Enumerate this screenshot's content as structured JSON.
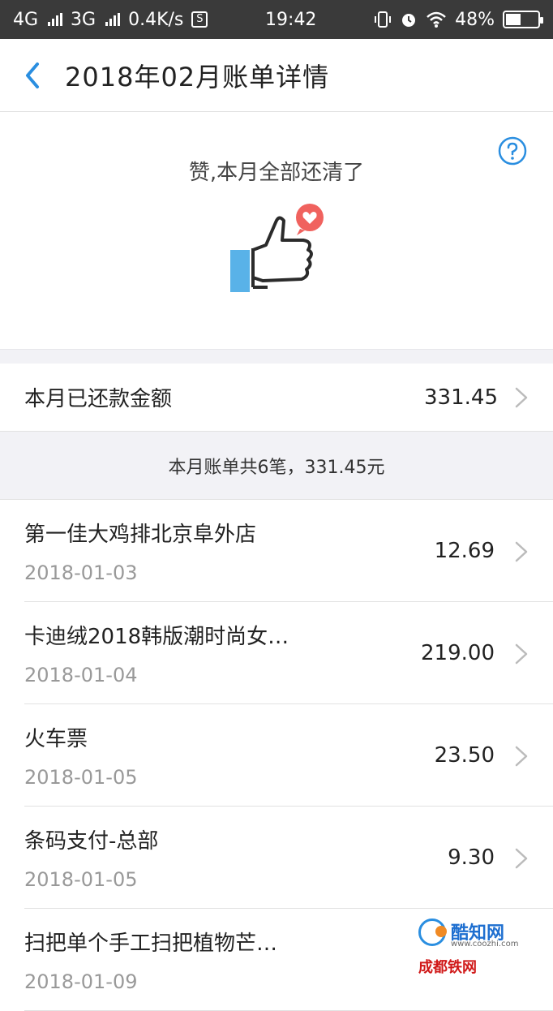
{
  "status_bar": {
    "network_1": "4G",
    "network_2": "3G",
    "speed": "0.4K/s",
    "s_badge": "S",
    "time": "19:42",
    "battery": "48%",
    "battery_level": 0.48
  },
  "header": {
    "title": "2018年02月账单详情"
  },
  "hero": {
    "message": "赞,本月全部还清了"
  },
  "paid": {
    "label": "本月已还款金额",
    "amount": "331.45"
  },
  "summary": "本月账单共6笔，331.45元",
  "bills": [
    {
      "name": "第一佳大鸡排北京阜外店",
      "date": "2018-01-03",
      "amount": "12.69"
    },
    {
      "name": "卡迪绒2018韩版潮时尚女…",
      "date": "2018-01-04",
      "amount": "219.00"
    },
    {
      "name": "火车票",
      "date": "2018-01-05",
      "amount": "23.50"
    },
    {
      "name": "条码支付-总部",
      "date": "2018-01-05",
      "amount": "9.30"
    },
    {
      "name": "扫把单个手工扫把植物芒…",
      "date": "2018-01-09",
      "amount": ""
    }
  ],
  "watermark": {
    "title": "酷知网",
    "url": "www.coozhi.com",
    "sub": "成都铁网"
  },
  "colors": {
    "accent": "#2a8ee0",
    "heart": "#f0625e"
  }
}
